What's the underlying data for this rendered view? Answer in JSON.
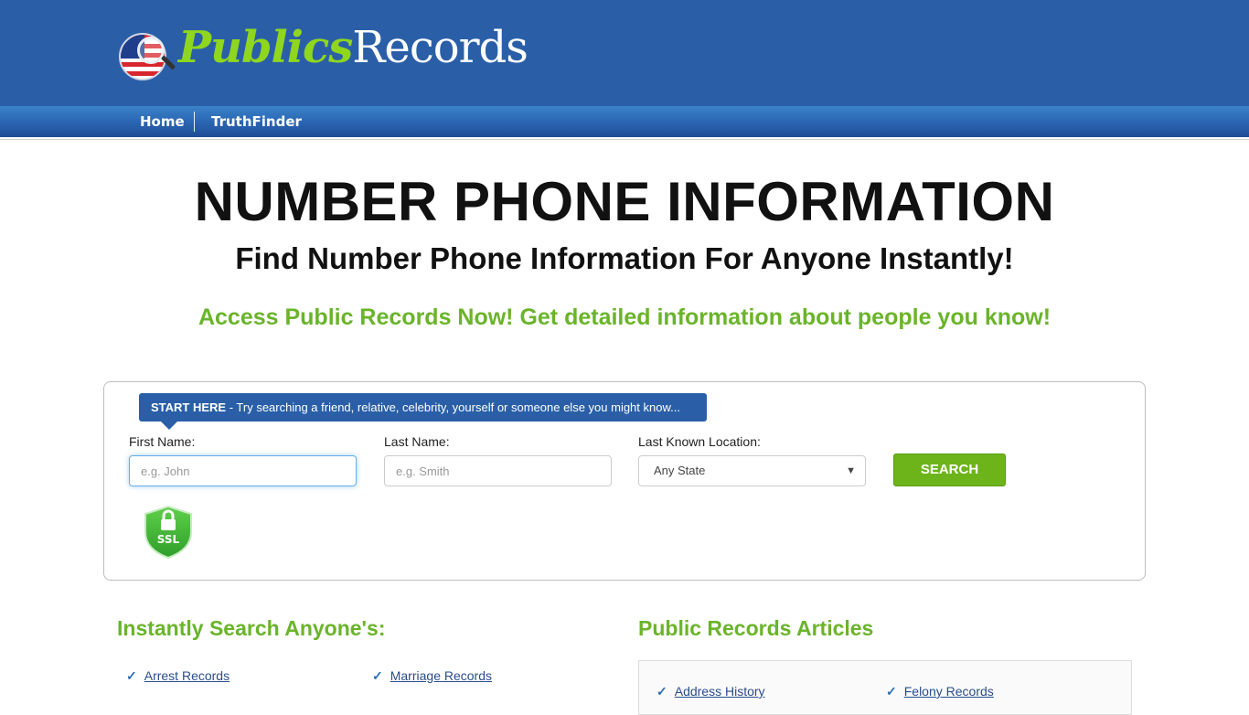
{
  "header": {
    "logo": {
      "part1": "Publics",
      "part2": "Records"
    },
    "nav": [
      {
        "label": "Home"
      },
      {
        "label": "TruthFinder"
      }
    ]
  },
  "hero": {
    "title": "NUMBER PHONE INFORMATION",
    "subtitle": "Find Number Phone Information For Anyone Instantly!",
    "tagline": "Access Public Records Now! Get detailed information about people you know!"
  },
  "search": {
    "tip_bold": "START HERE",
    "tip_text": " - Try searching a friend, relative, celebrity, yourself or someone else you might know...",
    "first_name": {
      "label": "First Name:",
      "placeholder": "e.g. John",
      "value": ""
    },
    "last_name": {
      "label": "Last Name:",
      "placeholder": "e.g. Smith",
      "value": ""
    },
    "location": {
      "label": "Last Known Location:",
      "selected": "Any State"
    },
    "button": "SEARCH",
    "ssl_label": "SSL"
  },
  "instant_search": {
    "title": "Instantly Search Anyone's:",
    "items": [
      {
        "label": "Arrest Records"
      },
      {
        "label": "Marriage Records"
      }
    ]
  },
  "articles": {
    "title": "Public Records Articles",
    "items": [
      {
        "label": "Address History"
      },
      {
        "label": "Felony Records"
      }
    ]
  },
  "colors": {
    "brand_blue": "#2a5fa8",
    "accent_green": "#6ab42a",
    "link_blue": "#2a4d8c"
  }
}
